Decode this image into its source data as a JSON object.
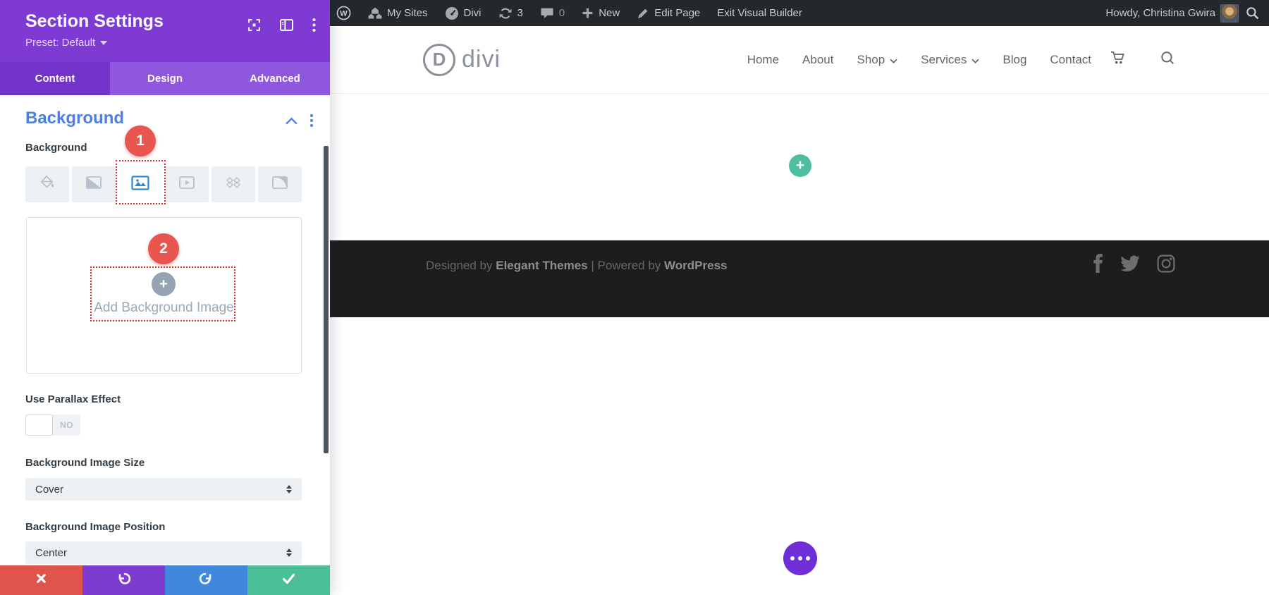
{
  "admin_bar": {
    "my_sites": "My Sites",
    "divi": "Divi",
    "updates_count": "3",
    "comments_count": "0",
    "new_label": "New",
    "edit_page": "Edit Page",
    "exit_builder": "Exit Visual Builder",
    "howdy": "Howdy, Christina Gwira"
  },
  "panel": {
    "title": "Section Settings",
    "preset": "Preset: Default",
    "tabs": [
      "Content",
      "Design",
      "Advanced"
    ],
    "section_title": "Background",
    "annotations": {
      "step1": "1",
      "step2": "2"
    },
    "background_types": [
      "color",
      "gradient",
      "image",
      "video",
      "pattern",
      "mask"
    ],
    "selected_background_type": "image",
    "fields": {
      "background_label": "Background",
      "add_image": "Add Background Image",
      "parallax_label": "Use Parallax Effect",
      "parallax_value": "NO",
      "size_label": "Background Image Size",
      "size_value": "Cover",
      "position_label": "Background Image Position",
      "position_value": "Center"
    }
  },
  "site": {
    "logo_letter": "D",
    "logo_text": "divi",
    "nav": [
      "Home",
      "About",
      "Shop",
      "Services",
      "Blog",
      "Contact"
    ],
    "footer": {
      "designed_by": "Designed by",
      "elegant_themes": "Elegant Themes",
      "separator": "|",
      "powered_by": "Powered by",
      "wordpress": "WordPress"
    }
  },
  "colors": {
    "adminbar_bg": "#23282d",
    "panel_purple": "#7e3ad2",
    "tabbar_purple": "#8e57de",
    "active_tab_purple": "#7433cb",
    "heading_blue": "#4c7fe1",
    "selected_blue": "#2b87da",
    "annotation_red": "#e8564f",
    "dotted_red": "#e02b20",
    "action_red": "#e0554b",
    "action_blue": "#4187dd",
    "action_green": "#4cbe9a",
    "add_button_green": "#4dbea0",
    "more_button_purple": "#6f2ed8",
    "footer_bg": "#1d1d1d"
  }
}
